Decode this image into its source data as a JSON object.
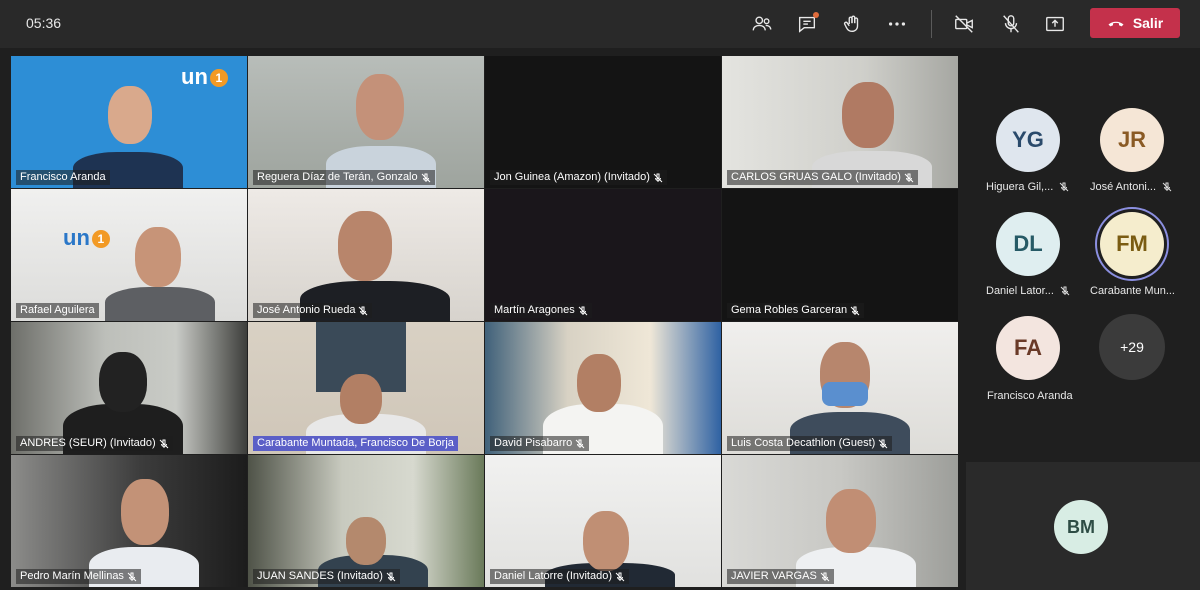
{
  "top_bar": {
    "time": "05:36",
    "leave_label": "Salir"
  },
  "tiles": [
    {
      "name": "Francisco Aranda",
      "mic": false
    },
    {
      "name": "Reguera Díaz de Terán, Gonzalo",
      "mic": true
    },
    {
      "name": "Jon Guinea (Amazon) (Invitado)",
      "mic": true
    },
    {
      "name": "CARLOS GRUAS GALO (Invitado)",
      "mic": true
    },
    {
      "name": "Rafael Aguilera",
      "mic": false
    },
    {
      "name": "José Antonio Rueda",
      "mic": true
    },
    {
      "name": "Martín Aragones",
      "mic": true
    },
    {
      "name": "Gema Robles Garceran",
      "mic": true
    },
    {
      "name": "ANDRES (SEUR) (Invitado)",
      "mic": true
    },
    {
      "name": "Carabante Muntada, Francisco De Borja",
      "mic": false,
      "active": true
    },
    {
      "name": "David Pisabarro",
      "mic": true
    },
    {
      "name": "Luis Costa Decathlon (Guest)",
      "mic": true
    },
    {
      "name": "Pedro Marín Mellinas",
      "mic": true
    },
    {
      "name": "JUAN SANDES (Invitado)",
      "mic": true
    },
    {
      "name": "Daniel Latorre (Invitado)",
      "mic": true
    },
    {
      "name": "JAVIER VARGAS",
      "mic": true
    }
  ],
  "logo_text": "un",
  "logo_badge": "1",
  "side_panel": {
    "participants": [
      {
        "initials": "YG",
        "name": "Higuera Gil,...",
        "mic_off": true
      },
      {
        "initials": "JR",
        "name": "José Antoni...",
        "mic_off": true
      },
      {
        "initials": "DL",
        "name": "Daniel Lator...",
        "mic_off": true
      },
      {
        "initials": "FM",
        "name": "Carabante Mun...",
        "mic_off": false
      },
      {
        "initials": "FA",
        "name": "Francisco Aranda",
        "mic_off": false
      }
    ],
    "more_count": "+29",
    "self_initials": "BM"
  },
  "colors": {
    "leave_button": "#c4314b",
    "active_speaker": "#5b5fc7",
    "logo_orange": "#f29a25"
  },
  "icons": [
    "people-icon",
    "chat-icon",
    "reactions-icon",
    "more-icon",
    "camera-off-icon",
    "mic-off-icon",
    "share-icon",
    "phone-icon"
  ]
}
